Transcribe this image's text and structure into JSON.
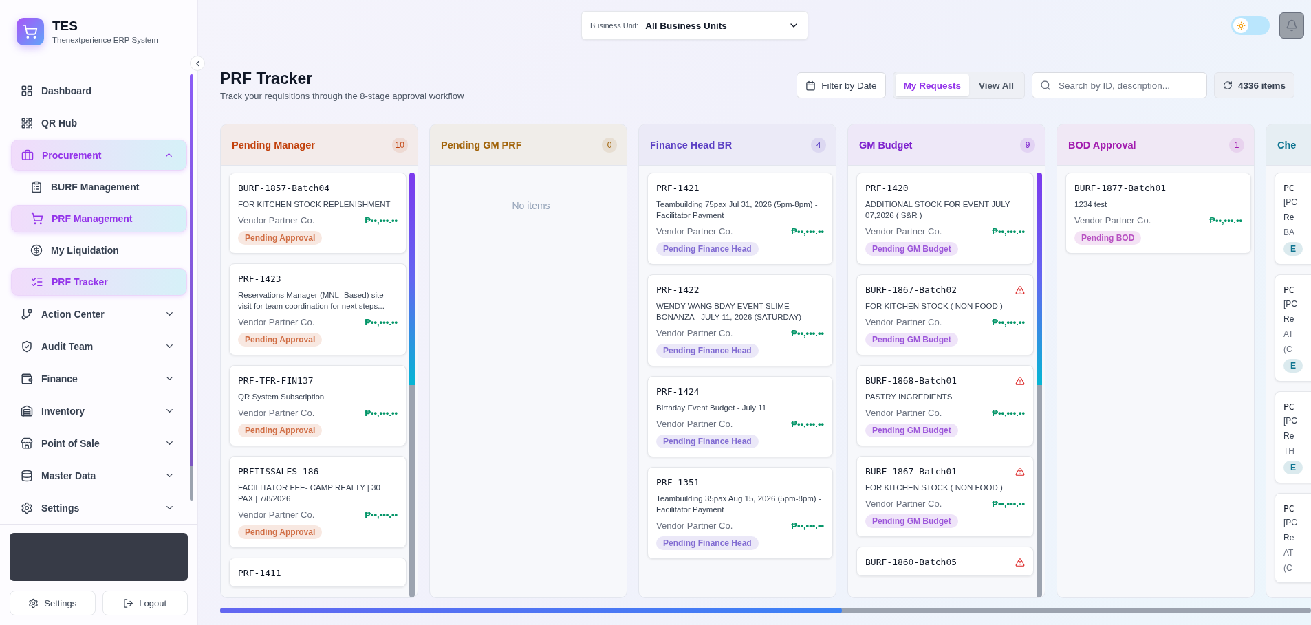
{
  "brand": {
    "name": "TES",
    "subtitle": "Thenextperience ERP System"
  },
  "nav": [
    {
      "label": "Dashboard",
      "selected": false
    },
    {
      "label": "QR Hub",
      "selected": false
    },
    {
      "label": "Procurement",
      "selected": true,
      "expanded": true,
      "children": [
        {
          "label": "BURF Management",
          "selected": false
        },
        {
          "label": "PRF Management",
          "selected": true
        },
        {
          "label": "My Liquidation",
          "selected": false
        },
        {
          "label": "PRF Tracker",
          "selected": true
        }
      ]
    },
    {
      "label": "Action Center",
      "selected": false,
      "expanded": false
    },
    {
      "label": "Audit Team",
      "selected": false,
      "expanded": false
    },
    {
      "label": "Finance",
      "selected": false,
      "expanded": false
    },
    {
      "label": "Inventory",
      "selected": false,
      "expanded": false
    },
    {
      "label": "Point of Sale",
      "selected": false,
      "expanded": false
    },
    {
      "label": "Master Data",
      "selected": false,
      "expanded": false
    },
    {
      "label": "Settings",
      "selected": false,
      "expanded": false
    }
  ],
  "sidebar_footer": {
    "buttons": [
      "Settings",
      "Logout"
    ]
  },
  "topbar": {
    "business_unit": {
      "label": "Business Unit:",
      "value": "All Business Units"
    },
    "theme_toggle": {
      "on": false
    }
  },
  "page": {
    "title": "PRF Tracker",
    "subtitle": "Track your requisitions through the 8-stage approval workflow"
  },
  "toolbar": {
    "filter_button": "Filter by Date",
    "tabs": [
      {
        "label": "My Requests",
        "selected": true
      },
      {
        "label": "View All",
        "selected": false
      }
    ],
    "search": {
      "placeholder": "Search by ID, description..."
    },
    "count": "4336 items"
  },
  "columns": [
    {
      "title": "Pending Manager",
      "count": "10",
      "color": "#c2410c",
      "cards": [
        {
          "id": "BURF-1857-Batch04",
          "description": "FOR KITCHEN STOCK REPLENISHMENT",
          "vendor": "Vendor Partner Co.",
          "amount": "₱••,•••.••",
          "status": "Pending Approval",
          "warning": false
        },
        {
          "id": "PRF-1423",
          "description": "Reservations Manager (MNL- Based) site visit for team coordination for next steps...",
          "vendor": "Vendor Partner Co.",
          "amount": "₱••,•••.••",
          "status": "Pending Approval",
          "warning": false
        },
        {
          "id": "PRF-TFR-FIN137",
          "description": "QR System Subscription",
          "vendor": "Vendor Partner Co.",
          "amount": "₱••,•••.••",
          "status": "Pending Approval",
          "warning": false
        },
        {
          "id": "PRFIISSALES-186",
          "description": "FACILITATOR FEE- CAMP REALTY | 30 PAX | 7/8/2026",
          "vendor": "Vendor Partner Co.",
          "amount": "₱••,•••.••",
          "status": "Pending Approval",
          "warning": false
        },
        {
          "id": "PRF-1411",
          "warning": false
        }
      ]
    },
    {
      "title": "Pending GM PRF",
      "count": "0",
      "color": "#a16207",
      "empty": "No items"
    },
    {
      "title": "Finance Head BR",
      "count": "4",
      "color": "#5b3fc4",
      "cards": [
        {
          "id": "PRF-1421",
          "description": "Teambuilding 75pax Jul 31, 2026 (5pm-8pm) - Facilitator Payment",
          "vendor": "Vendor Partner Co.",
          "amount": "₱••,•••.••",
          "status": "Pending Finance Head",
          "warning": false
        },
        {
          "id": "PRF-1422",
          "description": "WENDY WANG BDAY EVENT SLIME BONANZA - JULY 11, 2026 (SATURDAY)",
          "vendor": "Vendor Partner Co.",
          "amount": "₱••,•••.••",
          "status": "Pending Finance Head",
          "warning": false
        },
        {
          "id": "PRF-1424",
          "description": "Birthday Event Budget - July 11",
          "vendor": "Vendor Partner Co.",
          "amount": "₱••,•••.••",
          "status": "Pending Finance Head",
          "warning": false
        },
        {
          "id": "PRF-1351",
          "description": "Teambuilding 35pax Aug 15, 2026 (5pm-8pm) - Facilitator Payment",
          "vendor": "Vendor Partner Co.",
          "amount": "₱••,•••.••",
          "status": "Pending Finance Head",
          "warning": false
        }
      ]
    },
    {
      "title": "GM Budget",
      "count": "9",
      "color": "#7e22ce",
      "cards": [
        {
          "id": "PRF-1420",
          "description": "ADDITIONAL STOCK FOR EVENT JULY 07,2026 ( S&R )",
          "vendor": "Vendor Partner Co.",
          "amount": "₱••,•••.••",
          "status": "Pending GM Budget",
          "warning": false
        },
        {
          "id": "BURF-1867-Batch02",
          "description": "FOR KITCHEN STOCK ( NON FOOD )",
          "vendor": "Vendor Partner Co.",
          "amount": "₱••,•••.••",
          "status": "Pending GM Budget",
          "warning": true
        },
        {
          "id": "BURF-1868-Batch01",
          "description": "PASTRY INGREDIENTS",
          "vendor": "Vendor Partner Co.",
          "amount": "₱••,•••.••",
          "status": "Pending GM Budget",
          "warning": true
        },
        {
          "id": "BURF-1867-Batch01",
          "description": "FOR KITCHEN STOCK ( NON FOOD )",
          "vendor": "Vendor Partner Co.",
          "amount": "₱••,•••.••",
          "status": "Pending GM Budget",
          "warning": true
        },
        {
          "id": "BURF-1860-Batch05",
          "warning": true
        }
      ]
    },
    {
      "title": "BOD Approval",
      "count": "1",
      "color": "#a21caf",
      "cards": [
        {
          "id": "BURF-1877-Batch01",
          "description": "1234 test",
          "vendor": "Vendor Partner Co.",
          "amount": "₱••,•••.••",
          "status": "Pending BOD",
          "warning": false
        }
      ]
    },
    {
      "title": "Che",
      "color": "#0e7490",
      "cards": [
        {
          "id": "PC",
          "lines": [
            "[PC",
            "Re"
          ],
          "vendor_lines": [
            "BA"
          ],
          "status": "E"
        },
        {
          "id": "PC",
          "lines": [
            "[PC",
            "Re"
          ],
          "vendor_lines": [
            "AT",
            "(C"
          ],
          "status": "E"
        },
        {
          "id": "PC",
          "lines": [
            "[PC",
            "Re"
          ],
          "vendor_lines": [
            "TH"
          ],
          "status": "E"
        },
        {
          "id": "PC",
          "lines": [
            "[PC",
            "Re"
          ],
          "vendor_lines": [
            "AT",
            "(C"
          ]
        }
      ]
    }
  ]
}
